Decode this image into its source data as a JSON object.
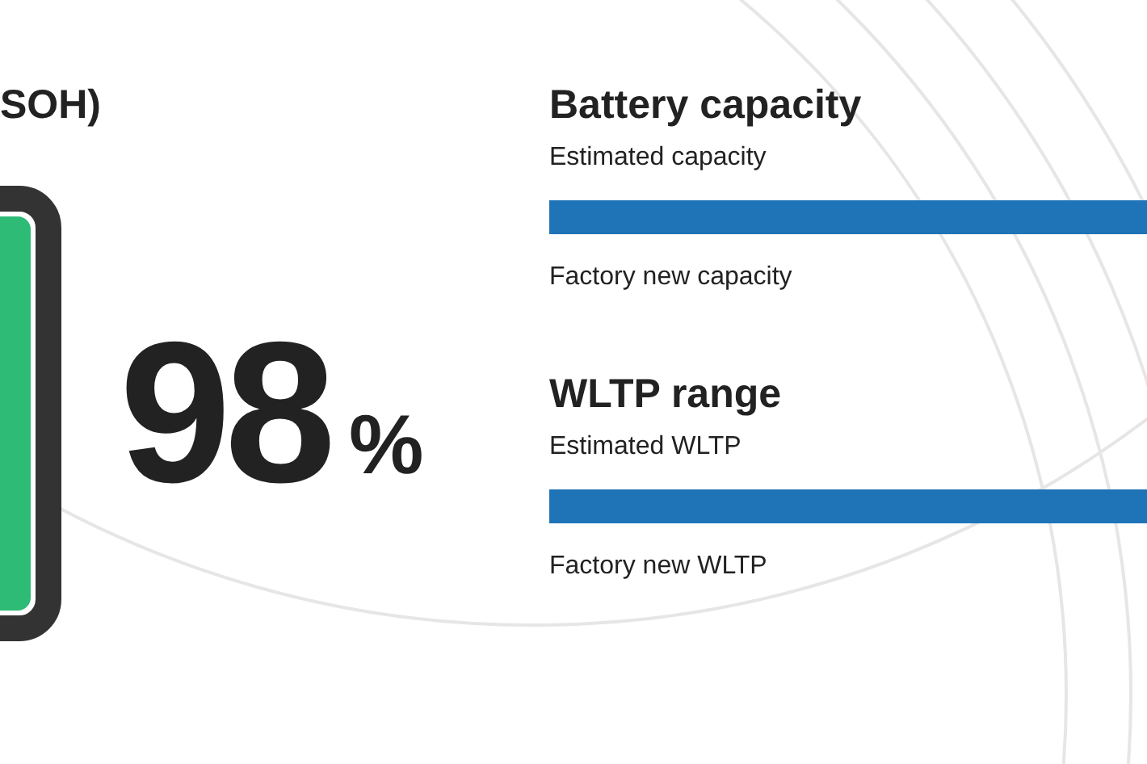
{
  "health": {
    "title": "SOH)",
    "value": "98",
    "unit": "%"
  },
  "capacity": {
    "title": "Battery capacity",
    "estimated_label": "Estimated capacity",
    "factory_label": "Factory new capacity"
  },
  "range": {
    "title": "WLTP range",
    "estimated_label": "Estimated WLTP",
    "factory_label": "Factory new WLTP"
  }
}
